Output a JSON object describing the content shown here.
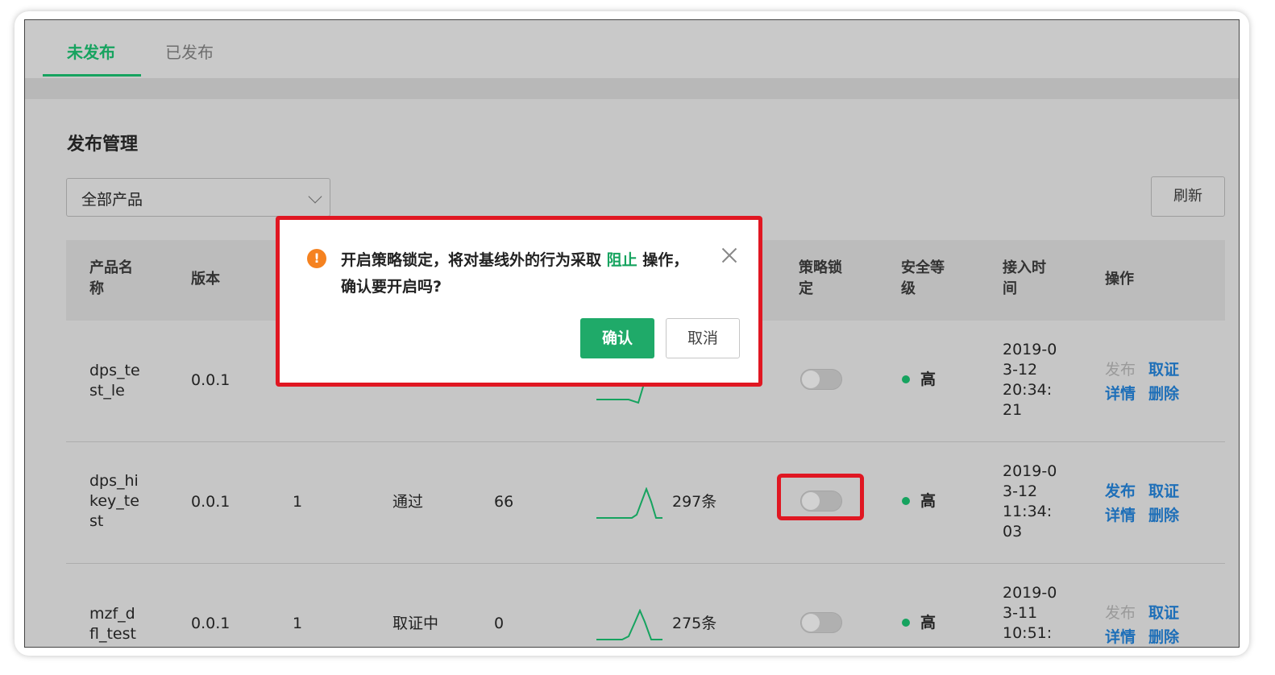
{
  "tabs": [
    {
      "label": "未发布",
      "active": true
    },
    {
      "label": "已发布",
      "active": false
    }
  ],
  "page": {
    "title": "发布管理",
    "product_select": "全部产品",
    "refresh_label": "刷新"
  },
  "columns": {
    "name": [
      "产品名",
      "称"
    ],
    "version": "版本",
    "lock": [
      "策略锁",
      "定"
    ],
    "security": [
      "安全等",
      "级"
    ],
    "time": [
      "接入时",
      "间"
    ],
    "actions": "操作"
  },
  "rows": [
    {
      "name": [
        "dps_te",
        "st_le"
      ],
      "version": "0.0.1",
      "col3": "",
      "status": "",
      "count": "",
      "records": "",
      "locked": false,
      "security": "高",
      "time": [
        "2019-0",
        "3-12",
        "20:34:",
        "21"
      ],
      "publish": "发布",
      "publish_enabled": false,
      "revoke": "取证",
      "detail": "详情",
      "delete": "删除"
    },
    {
      "name": [
        "dps_hi",
        "key_te",
        "st"
      ],
      "version": "0.0.1",
      "col3": "1",
      "status": "通过",
      "count": "66",
      "records": "297条",
      "locked": false,
      "security": "高",
      "time": [
        "2019-0",
        "3-12",
        "11:34:",
        "03"
      ],
      "publish": "发布",
      "publish_enabled": true,
      "revoke": "取证",
      "detail": "详情",
      "delete": "删除"
    },
    {
      "name": [
        "mzf_d",
        "fl_test"
      ],
      "version": "0.0.1",
      "col3": "1",
      "status": "取证中",
      "count": "0",
      "records": "275条",
      "locked": false,
      "security": "高",
      "time": [
        "2019-0",
        "3-11",
        "10:51:"
      ],
      "publish": "发布",
      "publish_enabled": false,
      "revoke": "取证",
      "detail": "详情",
      "delete": "删除"
    }
  ],
  "dialog": {
    "message_before": "开启策略锁定，将对基线外的行为采取",
    "message_highlight": "阻止",
    "message_after": " 操作，确认要开启吗?",
    "confirm": "确认",
    "cancel": "取消",
    "icon": "warning-icon"
  },
  "colors": {
    "accent": "#16a35f",
    "link": "#1e6fb8",
    "warning": "#f58220",
    "annotation": "#e01722"
  }
}
